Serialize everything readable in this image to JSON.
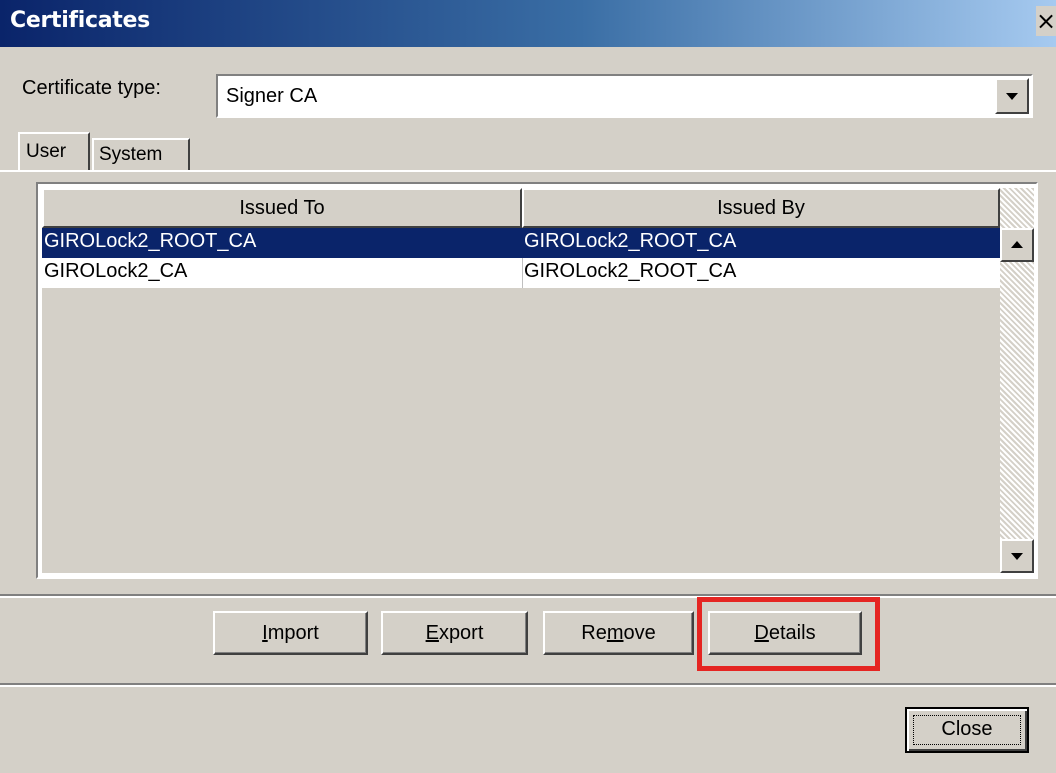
{
  "window": {
    "title": "Certificates",
    "close_glyph": "×"
  },
  "certificate_type": {
    "label": "Certificate type:",
    "selected": "Signer CA"
  },
  "tabs": [
    {
      "label": "User",
      "active": true
    },
    {
      "label": "System",
      "active": false
    }
  ],
  "table": {
    "columns": [
      "Issued To",
      "Issued By"
    ],
    "rows": [
      {
        "issued_to": "GIROLock2_ROOT_CA",
        "issued_by": "GIROLock2_ROOT_CA",
        "selected": true
      },
      {
        "issued_to": "GIROLock2_CA",
        "issued_by": "GIROLock2_ROOT_CA",
        "selected": false
      }
    ]
  },
  "actions": {
    "import": {
      "label": "Import",
      "mnemonic": "I",
      "rest": "mport"
    },
    "export": {
      "label": "Export",
      "mnemonic": "E",
      "rest": "xport"
    },
    "remove": {
      "label": "Remove",
      "before": "Re",
      "mnemonic": "m",
      "rest": "ove"
    },
    "details": {
      "label": "Details",
      "mnemonic": "D",
      "rest": "etails"
    }
  },
  "footer": {
    "close_label": "Close"
  },
  "colors": {
    "selection": "#0a246a",
    "highlight": "#e52522",
    "face": "#d4d0c8"
  },
  "icons": [
    "close-icon",
    "dropdown-arrow-icon",
    "scroll-up-icon",
    "scroll-down-icon"
  ]
}
